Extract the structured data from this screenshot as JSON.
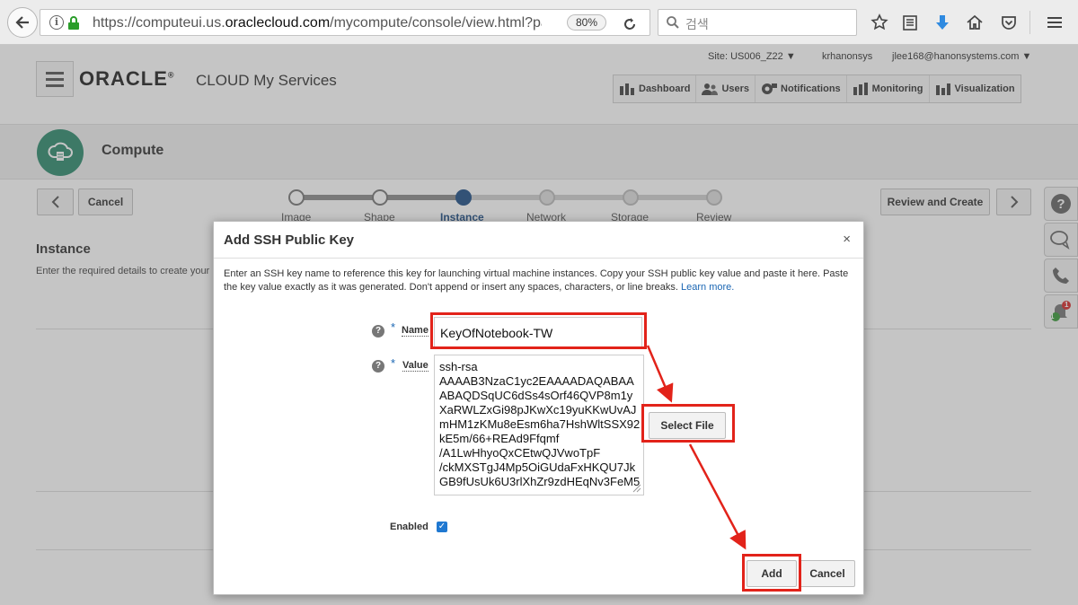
{
  "browser": {
    "url_prefix": "https://computeui.us.",
    "url_domain": "oraclecloud.com",
    "url_suffix": "/mycompute/console/view.html?page",
    "zoom": "80%",
    "search_placeholder": "검색"
  },
  "header": {
    "logo": "ORACLE",
    "logo_registered": "®",
    "product": "CLOUD My Services",
    "site": "Site: US006_Z22",
    "identity_domain": "krhanonsys",
    "user": "jlee168@hanonsystems.com",
    "nav": [
      {
        "label": "Dashboard",
        "icon": "dashboard-icon"
      },
      {
        "label": "Users",
        "icon": "users-icon"
      },
      {
        "label": "Notifications",
        "icon": "notifications-icon"
      },
      {
        "label": "Monitoring",
        "icon": "monitoring-icon"
      },
      {
        "label": "Visualization",
        "icon": "visualization-icon"
      }
    ]
  },
  "compute": {
    "title": "Compute"
  },
  "wizard": {
    "cancel_label": "Cancel",
    "review_create_label": "Review and Create",
    "steps": [
      "Image",
      "Shape",
      "Instance",
      "Network",
      "Storage",
      "Review"
    ],
    "current_step": "Instance"
  },
  "instance_section": {
    "title": "Instance",
    "description": "Enter the required details to create your"
  },
  "dialog": {
    "title": "Add SSH Public Key",
    "close": "×",
    "description": "Enter an SSH key name to reference this key for launching virtual machine instances. Copy your SSH public key value and paste it here. Paste the key value exactly as it was generated. Don't append or insert any spaces, characters, or line breaks.",
    "learn_more": "Learn more.",
    "name_label": "Name",
    "name_value": "KeyOfNotebook-TW",
    "value_label": "Value",
    "value_lines": [
      "ssh-rsa",
      "AAAAB3NzaC1yc2EAAAADAQABAA",
      "ABAQDSqUC6dSs4sOrf46QVP8m1y",
      "XaRWLZxGi98pJKwXc19yuKKwUvAJ",
      "mHM1zKMu8eEsm6ha7HshWltSSX92",
      "kE5m/66+REAd9Ffqmf",
      "/A1LwHhyoQxCEtwQJVwoTpF",
      "/ckMXSTgJ4Mp5OiGUdaFxHKQU7Jk",
      "GB9fUsUk6U3rlXhZr9zdHEqNv3FeM5"
    ],
    "select_file_label": "Select File",
    "enabled_label": "Enabled",
    "enabled": true,
    "add_label": "Add",
    "cancel_label": "Cancel",
    "required_mark": "*",
    "help_mark": "?"
  },
  "right_rail": {
    "notification_count": "1",
    "badge_green": "1"
  },
  "annotation_color": "#e2231a"
}
